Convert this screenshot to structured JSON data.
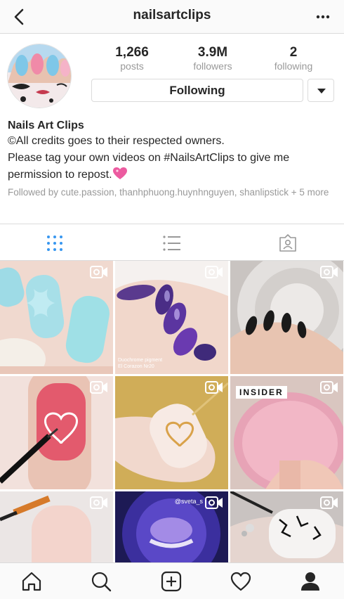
{
  "header": {
    "username": "nailsartclips",
    "back_icon": "chevron-left-icon",
    "more_icon": "more-horizontal-icon"
  },
  "profile": {
    "stats": [
      {
        "value": "1,266",
        "label": "posts"
      },
      {
        "value": "3.9M",
        "label": "followers"
      },
      {
        "value": "2",
        "label": "following"
      }
    ],
    "follow_button": "Following",
    "name": "Nails Art Clips",
    "bio_lines": [
      "©All credits goes to their respected owners.",
      "Please tag your own videos on #NailsArtClips to give me",
      "permission to repost."
    ],
    "followed_by": "Followed by cute.passion, thanhphuong.huynhnguyen, shanlipstick + 5 more"
  },
  "tabs": [
    {
      "icon": "grid-icon",
      "active": true
    },
    {
      "icon": "list-icon",
      "active": false
    },
    {
      "icon": "tagged-icon",
      "active": false
    }
  ],
  "posts": [
    {
      "type": "video",
      "caption": ""
    },
    {
      "type": "video",
      "caption": "Duochrome pigment El Corazon Nr20"
    },
    {
      "type": "video",
      "caption": ""
    },
    {
      "type": "video",
      "caption": ""
    },
    {
      "type": "video",
      "caption": ""
    },
    {
      "type": "video",
      "caption": "INSIDER"
    },
    {
      "type": "video",
      "caption": ""
    },
    {
      "type": "video",
      "caption": "@sveta_s"
    },
    {
      "type": "video",
      "caption": ""
    }
  ],
  "post_texts": {
    "caption_line1": "Duochrome pigment",
    "caption_line2": "El Corazon Nr20",
    "insider": "INSIDER",
    "handle": "@sveta_s"
  },
  "bottom_nav": [
    "home-icon",
    "search-icon",
    "add-post-icon",
    "activity-heart-icon",
    "profile-icon"
  ],
  "colors": {
    "active_tab": "#3897f0",
    "text": "#262626",
    "muted": "#999999",
    "border": "#dbdbdb"
  }
}
